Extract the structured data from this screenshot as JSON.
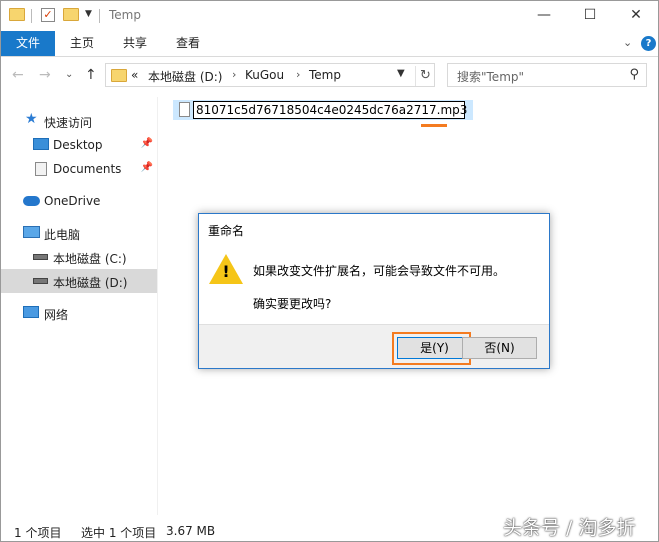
{
  "titlebar": {
    "title": "Temp",
    "minimize": "—",
    "maximize": "☐",
    "close": "✕"
  },
  "ribbon": {
    "tabs": [
      "文件",
      "主页",
      "共享",
      "查看"
    ]
  },
  "address": {
    "overflow": "«",
    "crumbs": [
      "本地磁盘 (D:)",
      "KuGou",
      "Temp"
    ],
    "separator": "›"
  },
  "search": {
    "placeholder": "搜索\"Temp\""
  },
  "sidebar": {
    "items": [
      {
        "label": "快速访问"
      },
      {
        "label": "Desktop"
      },
      {
        "label": "Documents"
      },
      {
        "label": "OneDrive"
      },
      {
        "label": "此电脑"
      },
      {
        "label": "本地磁盘 (C:)"
      },
      {
        "label": "本地磁盘 (D:)"
      },
      {
        "label": "网络"
      }
    ]
  },
  "file": {
    "name": "81071c5d76718504c4e0245dc76a2717.mp3"
  },
  "status": {
    "count": "1 个项目",
    "selected": "选中 1 个项目",
    "size": "3.67 MB"
  },
  "watermark": "头条号 / 淘多折",
  "dialog": {
    "title": "重命名",
    "message": "如果改变文件扩展名，可能会导致文件不可用。",
    "question": "确实要更改吗?",
    "yes_label": "是(Y)",
    "no_label": "否(N)"
  },
  "colors": {
    "accent": "#1979ca",
    "highlight": "#f47b20",
    "selection": "#cce8ff"
  }
}
